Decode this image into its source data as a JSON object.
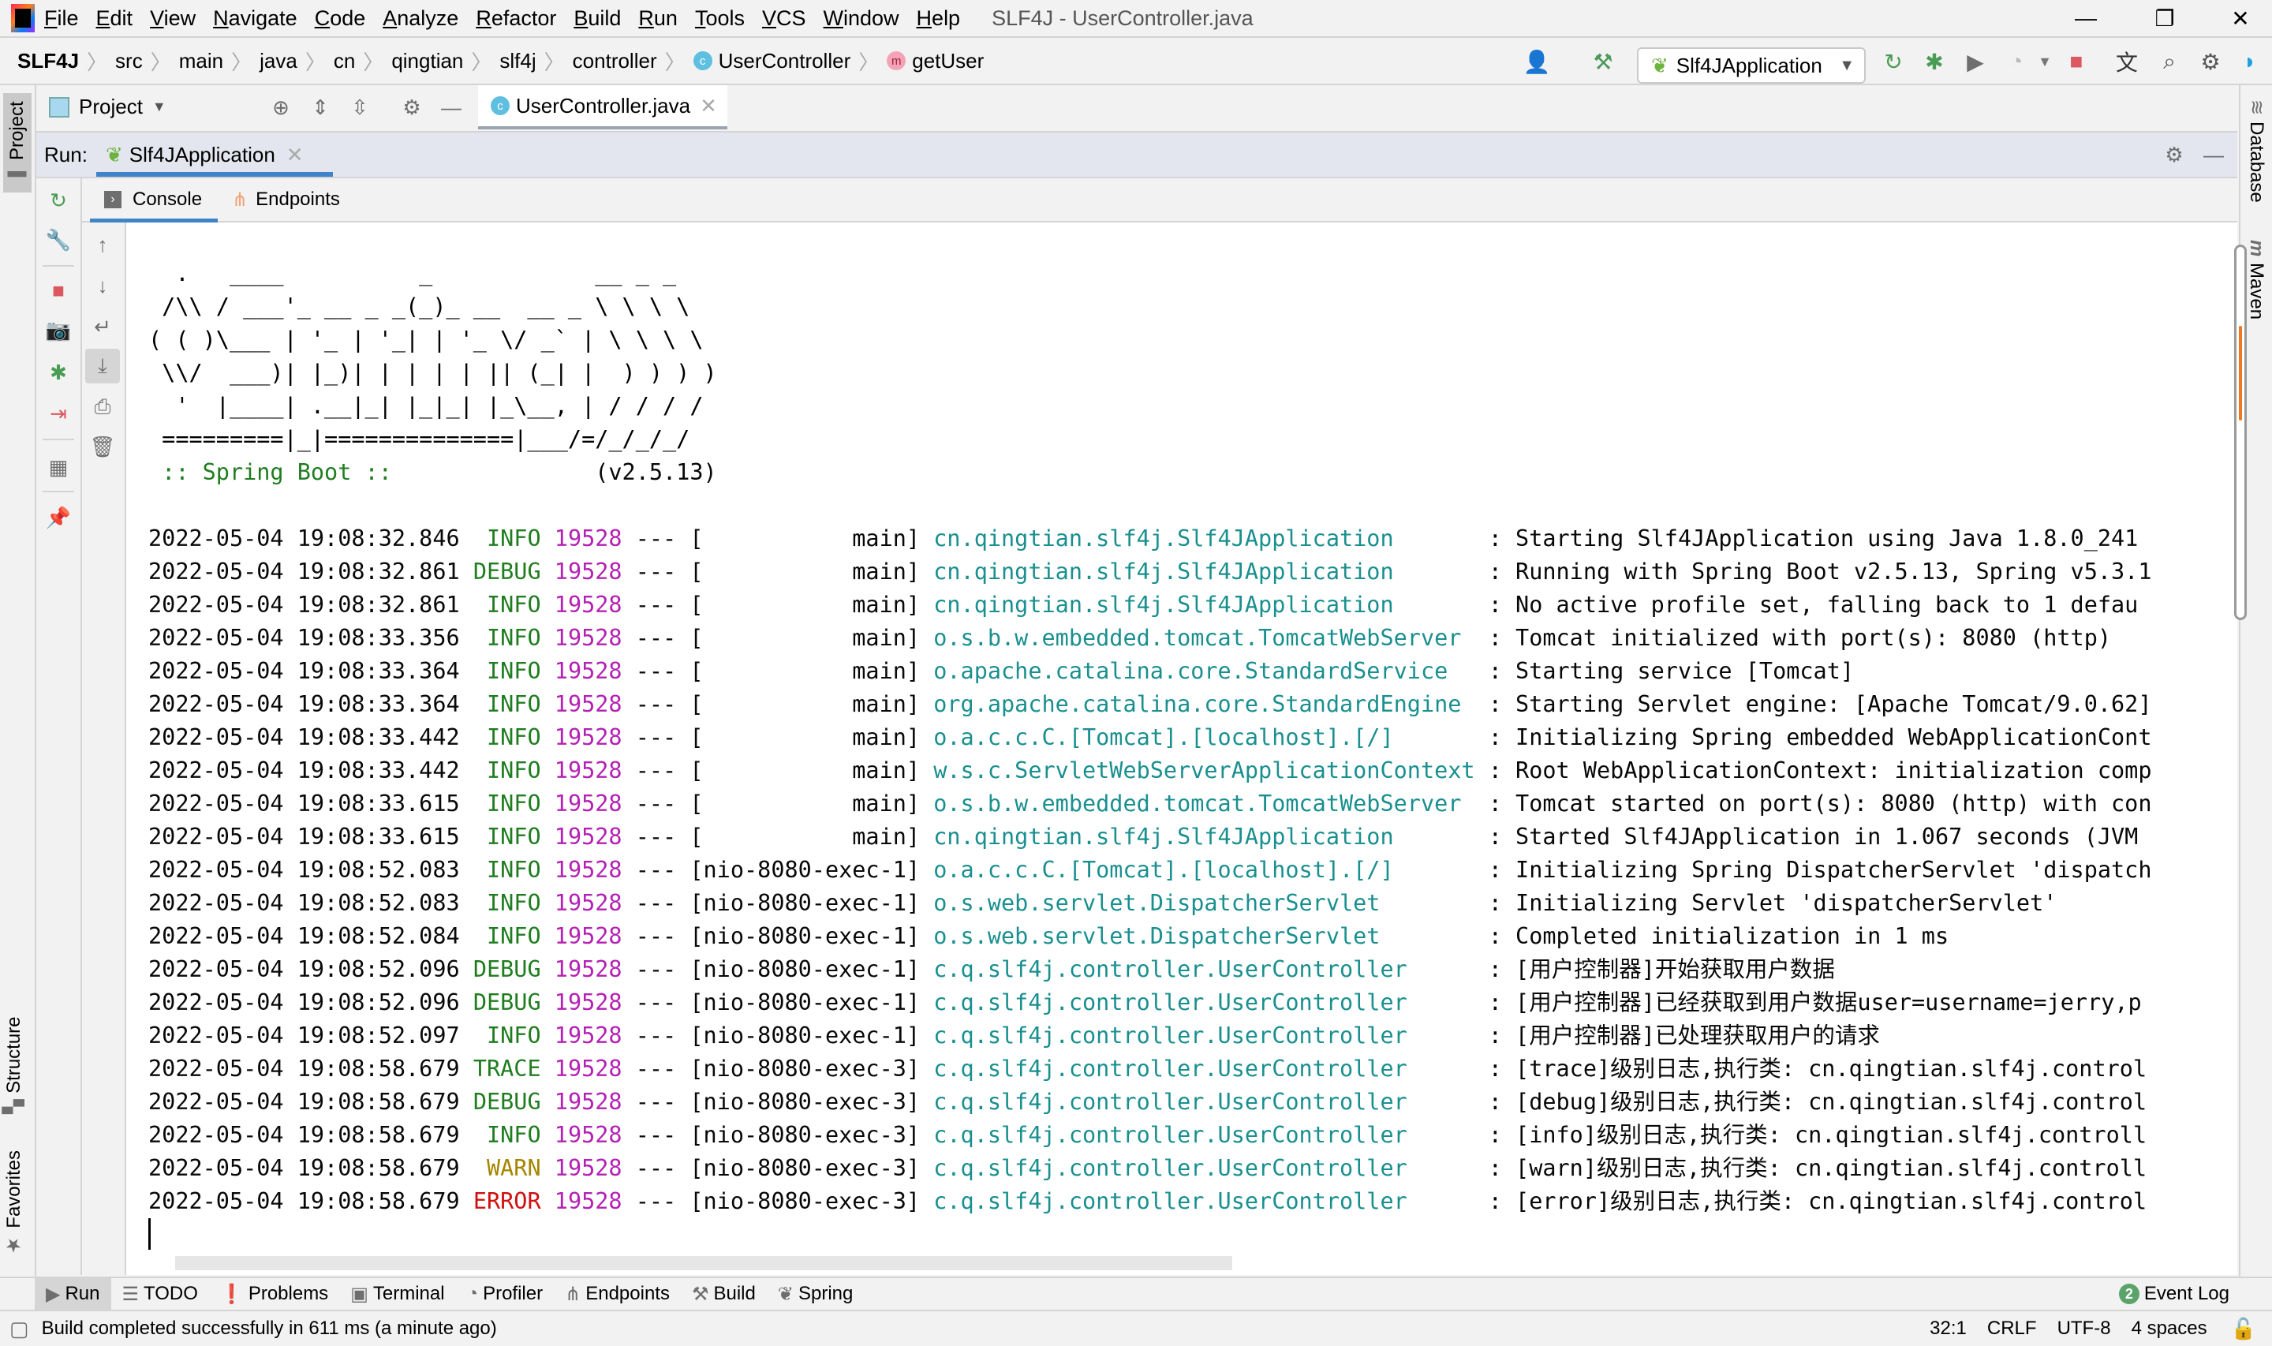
{
  "menu": {
    "items": [
      "File",
      "Edit",
      "View",
      "Navigate",
      "Code",
      "Analyze",
      "Refactor",
      "Build",
      "Run",
      "Tools",
      "VCS",
      "Window",
      "Help"
    ],
    "window_title": "SLF4J - UserController.java",
    "controls": {
      "minimize": "—",
      "restore": "❐",
      "close": "✕"
    }
  },
  "breadcrumb": {
    "items": [
      "SLF4J",
      "src",
      "main",
      "java",
      "cn",
      "qingtian",
      "slf4j",
      "controller",
      "UserController",
      "getUser"
    ],
    "class_badge": "c",
    "method_badge": "m"
  },
  "toolbar": {
    "run_config": "Slf4JApplication",
    "icons": [
      "vcs-user-icon",
      "build-hammer-icon",
      "rerun-icon",
      "debug-icon",
      "coverage-icon",
      "profile-icon",
      "stop-icon",
      "translate-icon",
      "search-icon",
      "settings-icon",
      "toolbox-icon"
    ]
  },
  "project_panel": {
    "label": "Project",
    "editor_tab": "UserController.java"
  },
  "side_tabs": {
    "left": [
      "Project",
      "Structure",
      "Favorites"
    ],
    "right": [
      "Database",
      "Maven"
    ]
  },
  "run_panel": {
    "label": "Run:",
    "tab": "Slf4JApplication",
    "subtabs": [
      "Console",
      "Endpoints"
    ]
  },
  "console": {
    "banner": [
      "  .   ____          _            __ _ _",
      " /\\\\ / ___'_ __ _ _(_)_ __  __ _ \\ \\ \\ \\",
      "( ( )\\___ | '_ | '_| | '_ \\/ _` | \\ \\ \\ \\",
      " \\\\/  ___)| |_)| | | | | || (_| |  ) ) ) )",
      "  '  |____| .__|_| |_|_| |_\\__, | / / / /",
      " =========|_|==============|___/=/_/_/_/"
    ],
    "spring_label": " :: Spring Boot :: ",
    "spring_version": "              (v2.5.13)",
    "logs": [
      {
        "ts": "2022-05-04 19:08:32.846",
        "level": "INFO",
        "pid": "19528",
        "thread": "           main",
        "logger": "cn.qingtian.slf4j.Slf4JApplication      ",
        "msg": "Starting Slf4JApplication using Java 1.8.0_241"
      },
      {
        "ts": "2022-05-04 19:08:32.861",
        "level": "DEBUG",
        "pid": "19528",
        "thread": "           main",
        "logger": "cn.qingtian.slf4j.Slf4JApplication      ",
        "msg": "Running with Spring Boot v2.5.13, Spring v5.3.1"
      },
      {
        "ts": "2022-05-04 19:08:32.861",
        "level": "INFO",
        "pid": "19528",
        "thread": "           main",
        "logger": "cn.qingtian.slf4j.Slf4JApplication      ",
        "msg": "No active profile set, falling back to 1 defau"
      },
      {
        "ts": "2022-05-04 19:08:33.356",
        "level": "INFO",
        "pid": "19528",
        "thread": "           main",
        "logger": "o.s.b.w.embedded.tomcat.TomcatWebServer ",
        "msg": "Tomcat initialized with port(s): 8080 (http)"
      },
      {
        "ts": "2022-05-04 19:08:33.364",
        "level": "INFO",
        "pid": "19528",
        "thread": "           main",
        "logger": "o.apache.catalina.core.StandardService  ",
        "msg": "Starting service [Tomcat]"
      },
      {
        "ts": "2022-05-04 19:08:33.364",
        "level": "INFO",
        "pid": "19528",
        "thread": "           main",
        "logger": "org.apache.catalina.core.StandardEngine ",
        "msg": "Starting Servlet engine: [Apache Tomcat/9.0.62]"
      },
      {
        "ts": "2022-05-04 19:08:33.442",
        "level": "INFO",
        "pid": "19528",
        "thread": "           main",
        "logger": "o.a.c.c.C.[Tomcat].[localhost].[/]      ",
        "msg": "Initializing Spring embedded WebApplicationCont"
      },
      {
        "ts": "2022-05-04 19:08:33.442",
        "level": "INFO",
        "pid": "19528",
        "thread": "           main",
        "logger": "w.s.c.ServletWebServerApplicationContext",
        "msg": "Root WebApplicationContext: initialization comp"
      },
      {
        "ts": "2022-05-04 19:08:33.615",
        "level": "INFO",
        "pid": "19528",
        "thread": "           main",
        "logger": "o.s.b.w.embedded.tomcat.TomcatWebServer ",
        "msg": "Tomcat started on port(s): 8080 (http) with con"
      },
      {
        "ts": "2022-05-04 19:08:33.615",
        "level": "INFO",
        "pid": "19528",
        "thread": "           main",
        "logger": "cn.qingtian.slf4j.Slf4JApplication      ",
        "msg": "Started Slf4JApplication in 1.067 seconds (JVM"
      },
      {
        "ts": "2022-05-04 19:08:52.083",
        "level": "INFO",
        "pid": "19528",
        "thread": "nio-8080-exec-1",
        "logger": "o.a.c.c.C.[Tomcat].[localhost].[/]      ",
        "msg": "Initializing Spring DispatcherServlet 'dispatch"
      },
      {
        "ts": "2022-05-04 19:08:52.083",
        "level": "INFO",
        "pid": "19528",
        "thread": "nio-8080-exec-1",
        "logger": "o.s.web.servlet.DispatcherServlet       ",
        "msg": "Initializing Servlet 'dispatcherServlet'"
      },
      {
        "ts": "2022-05-04 19:08:52.084",
        "level": "INFO",
        "pid": "19528",
        "thread": "nio-8080-exec-1",
        "logger": "o.s.web.servlet.DispatcherServlet       ",
        "msg": "Completed initialization in 1 ms"
      },
      {
        "ts": "2022-05-04 19:08:52.096",
        "level": "DEBUG",
        "pid": "19528",
        "thread": "nio-8080-exec-1",
        "logger": "c.q.slf4j.controller.UserController     ",
        "msg": "[用户控制器]开始获取用户数据"
      },
      {
        "ts": "2022-05-04 19:08:52.096",
        "level": "DEBUG",
        "pid": "19528",
        "thread": "nio-8080-exec-1",
        "logger": "c.q.slf4j.controller.UserController     ",
        "msg": "[用户控制器]已经获取到用户数据user=username=jerry,p"
      },
      {
        "ts": "2022-05-04 19:08:52.097",
        "level": "INFO",
        "pid": "19528",
        "thread": "nio-8080-exec-1",
        "logger": "c.q.slf4j.controller.UserController     ",
        "msg": "[用户控制器]已处理获取用户的请求"
      },
      {
        "ts": "2022-05-04 19:08:58.679",
        "level": "TRACE",
        "pid": "19528",
        "thread": "nio-8080-exec-3",
        "logger": "c.q.slf4j.controller.UserController     ",
        "msg": "[trace]级别日志,执行类: cn.qingtian.slf4j.control"
      },
      {
        "ts": "2022-05-04 19:08:58.679",
        "level": "DEBUG",
        "pid": "19528",
        "thread": "nio-8080-exec-3",
        "logger": "c.q.slf4j.controller.UserController     ",
        "msg": "[debug]级别日志,执行类: cn.qingtian.slf4j.control"
      },
      {
        "ts": "2022-05-04 19:08:58.679",
        "level": "INFO",
        "pid": "19528",
        "thread": "nio-8080-exec-3",
        "logger": "c.q.slf4j.controller.UserController     ",
        "msg": "[info]级别日志,执行类: cn.qingtian.slf4j.controll"
      },
      {
        "ts": "2022-05-04 19:08:58.679",
        "level": "WARN",
        "pid": "19528",
        "thread": "nio-8080-exec-3",
        "logger": "c.q.slf4j.controller.UserController     ",
        "msg": "[warn]级别日志,执行类: cn.qingtian.slf4j.controll"
      },
      {
        "ts": "2022-05-04 19:08:58.679",
        "level": "ERROR",
        "pid": "19528",
        "thread": "nio-8080-exec-3",
        "logger": "c.q.slf4j.controller.UserController     ",
        "msg": "[error]级别日志,执行类: cn.qingtian.slf4j.control"
      }
    ]
  },
  "bottom_tabs": [
    "Run",
    "TODO",
    "Problems",
    "Terminal",
    "Profiler",
    "Endpoints",
    "Build",
    "Spring"
  ],
  "event_log": {
    "count": "2",
    "label": "Event Log"
  },
  "status": {
    "message": "Build completed successfully in 611 ms (a minute ago)",
    "position": "32:1",
    "line_sep": "CRLF",
    "encoding": "UTF-8",
    "indent": "4 spaces"
  }
}
